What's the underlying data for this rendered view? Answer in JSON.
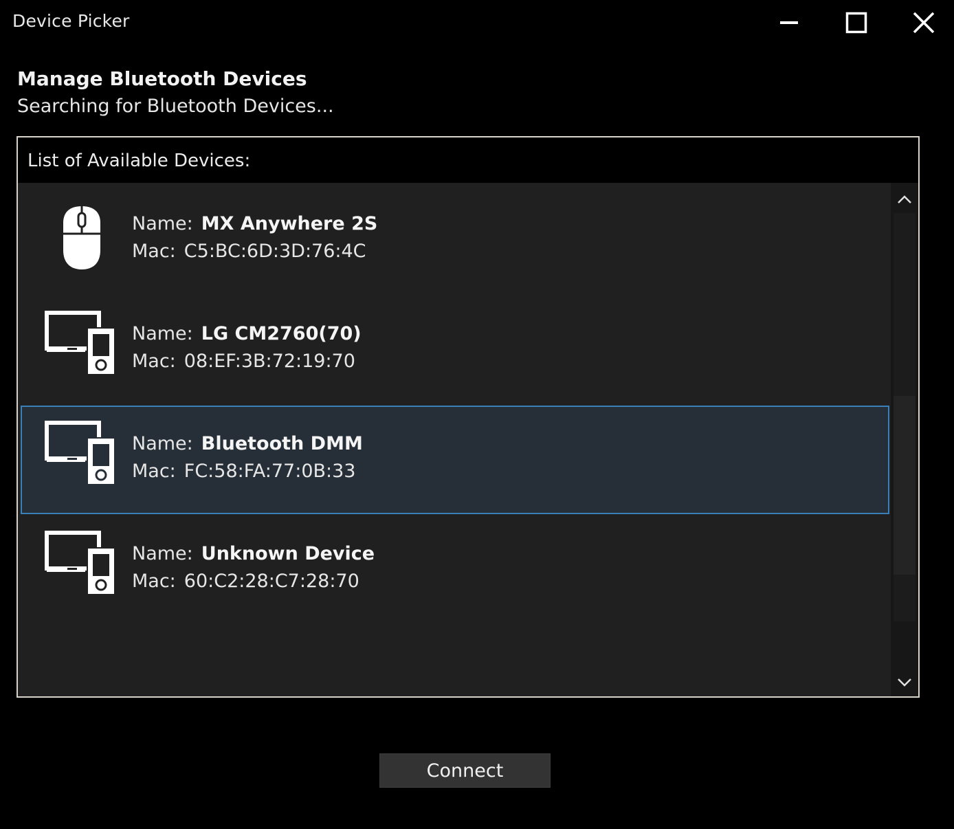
{
  "window": {
    "title": "Device Picker"
  },
  "heading": "Manage Bluetooth Devices",
  "status": "Searching for Bluetooth Devices...",
  "list": {
    "header": "List of Available Devices:",
    "name_label": "Name:",
    "mac_label": "Mac:",
    "devices": [
      {
        "icon": "mouse-icon",
        "name": "MX Anywhere 2S",
        "mac": "C5:BC:6D:3D:76:4C",
        "selected": false
      },
      {
        "icon": "devices-icon",
        "name": "LG CM2760(70)",
        "mac": "08:EF:3B:72:19:70",
        "selected": false
      },
      {
        "icon": "devices-icon",
        "name": "Bluetooth DMM",
        "mac": "FC:58:FA:77:0B:33",
        "selected": true
      },
      {
        "icon": "devices-icon",
        "name": "Unknown Device",
        "mac": "60:C2:28:C7:28:70",
        "selected": false
      }
    ]
  },
  "actions": {
    "connect_label": "Connect"
  },
  "colors": {
    "background": "#000000",
    "list_background": "#202020",
    "selection_fill": "#262f37",
    "selection_border": "#3a7fb8",
    "button_fill": "#333333"
  }
}
